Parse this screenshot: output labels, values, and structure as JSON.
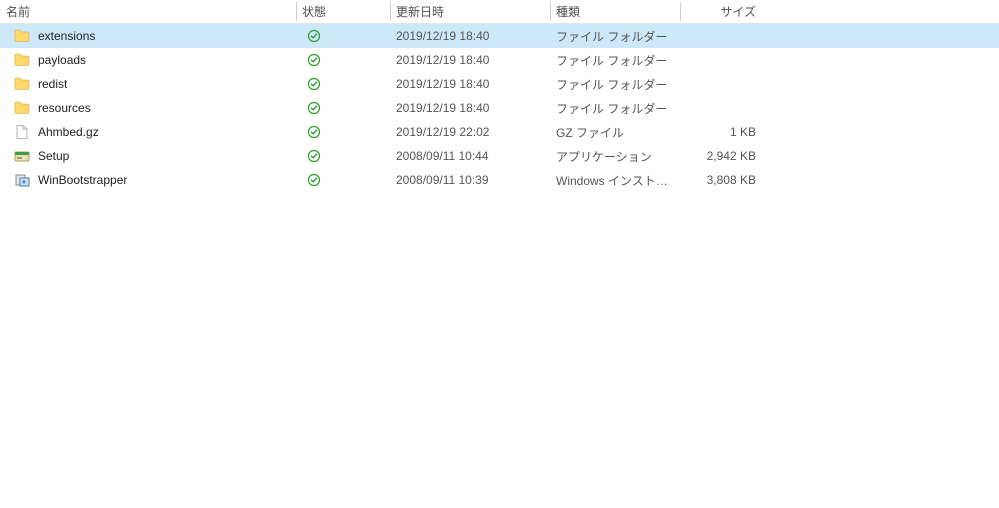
{
  "columns": {
    "name": "名前",
    "status": "状態",
    "date": "更新日時",
    "type": "種類",
    "size": "サイズ"
  },
  "items": [
    {
      "icon": "folder",
      "name": "extensions",
      "status": "synced",
      "date": "2019/12/19 18:40",
      "type": "ファイル フォルダー",
      "size": "",
      "selected": true
    },
    {
      "icon": "folder",
      "name": "payloads",
      "status": "synced",
      "date": "2019/12/19 18:40",
      "type": "ファイル フォルダー",
      "size": "",
      "selected": false
    },
    {
      "icon": "folder",
      "name": "redist",
      "status": "synced",
      "date": "2019/12/19 18:40",
      "type": "ファイル フォルダー",
      "size": "",
      "selected": false
    },
    {
      "icon": "folder",
      "name": "resources",
      "status": "synced",
      "date": "2019/12/19 18:40",
      "type": "ファイル フォルダー",
      "size": "",
      "selected": false
    },
    {
      "icon": "file",
      "name": "Ahmbed.gz",
      "status": "synced",
      "date": "2019/12/19 22:02",
      "type": "GZ ファイル",
      "size": "1 KB",
      "selected": false
    },
    {
      "icon": "setup",
      "name": "Setup",
      "status": "synced",
      "date": "2008/09/11 10:44",
      "type": "アプリケーション",
      "size": "2,942 KB",
      "selected": false
    },
    {
      "icon": "installer",
      "name": "WinBootstrapper",
      "status": "synced",
      "date": "2008/09/11 10:39",
      "type": "Windows インスト…",
      "size": "3,808 KB",
      "selected": false
    }
  ]
}
